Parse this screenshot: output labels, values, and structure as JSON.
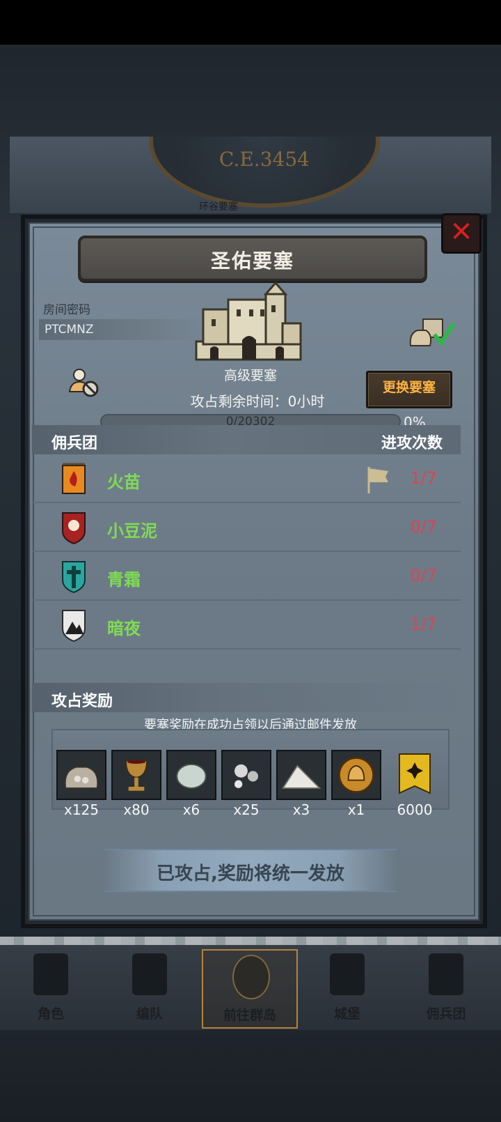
{
  "background": {
    "era": "C.E.3454",
    "world_label": "环谷要塞"
  },
  "panel": {
    "title": "圣佑要塞",
    "room_password_label": "房间密码",
    "room_password_value": "PTCMNZ",
    "fortress_type": "高级要塞",
    "time_label": "攻占剩余时间：",
    "time_value": "0小时",
    "change_button": "更换要塞",
    "progress": {
      "text": "0/20302",
      "current": 0,
      "total": 20302,
      "percent": "0%"
    },
    "mercenary_header": "佣兵团",
    "attacks_header": "进攻次数",
    "mercenaries": [
      {
        "name": "火苗",
        "count": "1/7",
        "emblem": "orange-fire-banner-icon",
        "flag": true
      },
      {
        "name": "小豆泥",
        "count": "0/7",
        "emblem": "red-sun-shield-icon",
        "flag": false
      },
      {
        "name": "青霜",
        "count": "0/7",
        "emblem": "teal-cross-shield-icon",
        "flag": false
      },
      {
        "name": "暗夜",
        "count": "1/7",
        "emblem": "white-mountain-shield-icon",
        "flag": false
      }
    ],
    "reward_header": "攻占奖励",
    "reward_note": "要塞奖励在成功占领以后通过邮件发放",
    "rewards": [
      {
        "icon": "ore-sack-icon",
        "qty": "x125"
      },
      {
        "icon": "goblet-icon",
        "qty": "x80"
      },
      {
        "icon": "moonstone-icon",
        "qty": "x6"
      },
      {
        "icon": "silver-orbs-icon",
        "qty": "x25"
      },
      {
        "icon": "salt-pile-icon",
        "qty": "x3"
      },
      {
        "icon": "golden-helmet-coin-icon",
        "qty": "x1"
      },
      {
        "icon": "guild-banner-icon",
        "qty": "6000"
      }
    ],
    "status": "已攻占,奖励将统一发放"
  },
  "nav": [
    {
      "label": "角色",
      "icon": "character-icon",
      "active": false
    },
    {
      "label": "编队",
      "icon": "formation-icon",
      "active": false
    },
    {
      "label": "前往群岛",
      "icon": "islands-icon",
      "active": true
    },
    {
      "label": "城堡",
      "icon": "castle-icon",
      "active": false
    },
    {
      "label": "佣兵团",
      "icon": "mercenary-icon",
      "active": false
    }
  ],
  "colors": {
    "accent_orange": "#ffb341",
    "name_green": "#7fdc53",
    "count_red": "#d94553"
  }
}
